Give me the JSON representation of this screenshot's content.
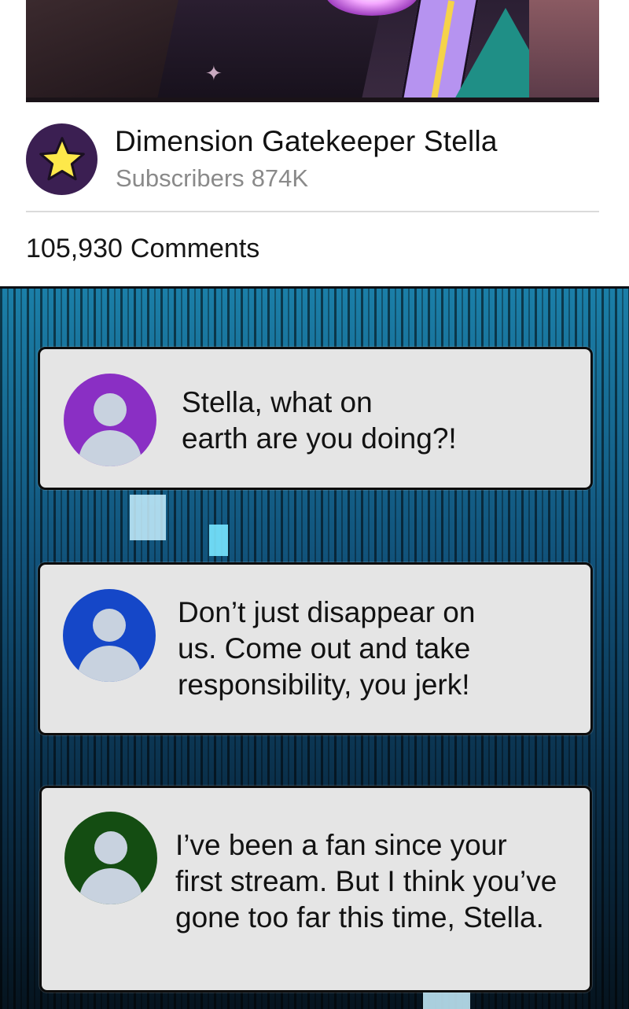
{
  "channel": {
    "name": "Dimension Gatekeeper Stella",
    "subscribers_label": "Subscribers",
    "subscribers_count": "874K",
    "avatar_icon": "star-icon",
    "avatar_color": "#3b1f52",
    "star_color": "#fde84a"
  },
  "comments_header": {
    "count": "105,930",
    "label": "Comments"
  },
  "comments": [
    {
      "avatar_icon": "user-icon",
      "avatar_color": "#8a2fc4",
      "lines": [
        "Stella, what on",
        "earth are you doing?!"
      ]
    },
    {
      "avatar_icon": "user-icon",
      "avatar_color": "#1547c8",
      "lines": [
        "Don’t just disappear on",
        "us. Come out and take",
        "responsibility, you jerk!"
      ]
    },
    {
      "avatar_icon": "user-icon",
      "avatar_color": "#144d12",
      "lines": [
        "I’ve been a fan since your",
        "first stream. But I think you’ve",
        "gone too far this time, Stella."
      ]
    }
  ]
}
